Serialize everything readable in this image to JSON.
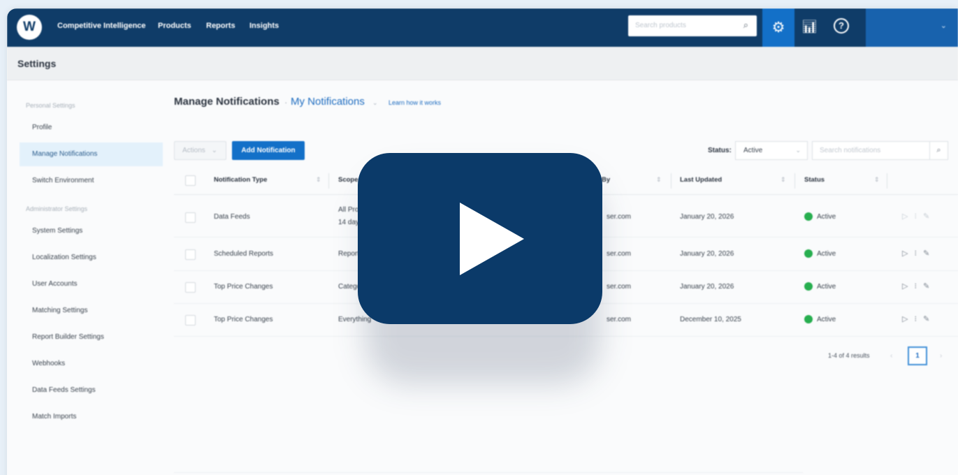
{
  "nav": {
    "logo": "W",
    "items": [
      "Competitive Intelligence",
      "Products",
      "Reports",
      "Insights"
    ],
    "search_placeholder": "Search products",
    "help_glyph": "?",
    "user_chevron": "⌄"
  },
  "page_header": {
    "title": "Settings"
  },
  "sidebar": {
    "personal_heading": "Personal Settings",
    "personal_items": [
      "Profile",
      "Manage Notifications",
      "Switch Environment"
    ],
    "admin_heading": "Administrator Settings",
    "admin_items": [
      "System Settings",
      "Localization Settings",
      "User Accounts",
      "Matching Settings",
      "Report Builder Settings",
      "Webhooks",
      "Data Feeds Settings",
      "Match Imports"
    ],
    "active_item": "Manage Notifications"
  },
  "main": {
    "title": "Manage Notifications",
    "separator": "·",
    "scope_dropdown": "My Notifications",
    "dropdown_chevron": "⌄",
    "learn_link": "Learn how it works",
    "actions_label": "Actions",
    "add_button": "Add Notification",
    "status_label": "Status:",
    "status_value": "Active",
    "search_placeholder": "Search notifications"
  },
  "table": {
    "columns": [
      "Notification Type",
      "Scope",
      "By",
      "Last Updated",
      "Status"
    ],
    "rows": [
      {
        "type": "Data Feeds",
        "scope_line1": "All Prod",
        "scope_line2": "14 days",
        "by": "ser.com",
        "updated": "January 20, 2026",
        "status": "Active"
      },
      {
        "type": "Scheduled Reports",
        "scope_line1": "Report",
        "scope_line2": "",
        "by": "ser.com",
        "updated": "January 20, 2026",
        "status": "Active"
      },
      {
        "type": "Top Price Changes",
        "scope_line1": "Categor",
        "scope_line2": "",
        "by": "ser.com",
        "updated": "January 20, 2026",
        "status": "Active"
      },
      {
        "type": "Top Price Changes",
        "scope_line1": "Everything",
        "scope_line2": "",
        "by": "ser.com",
        "updated": "December 10, 2025",
        "status": "Active"
      }
    ],
    "row_actions": "▷ ⁝ ✎"
  },
  "pagination": {
    "summary": "1-4 of 4 results",
    "current_page": "1",
    "prev": "‹",
    "next": "›"
  },
  "colors": {
    "topbar": "#0f3c68",
    "accent": "#1370c8",
    "active_status": "#27ae4f",
    "play_button": "#0b3a69"
  }
}
